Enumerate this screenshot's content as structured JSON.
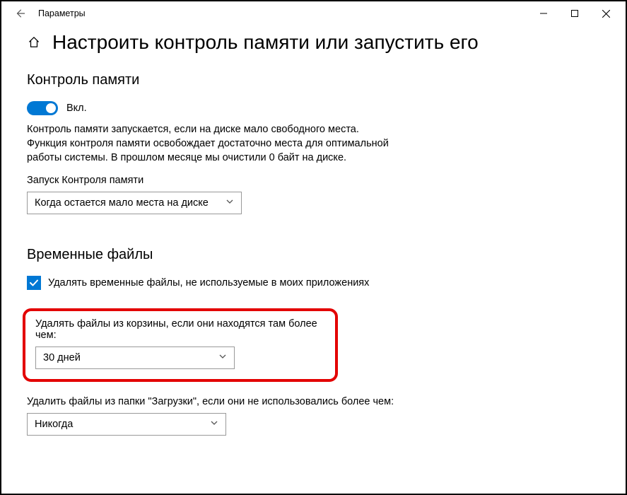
{
  "window": {
    "title": "Параметры"
  },
  "page": {
    "title": "Настроить контроль памяти или запустить его"
  },
  "section1": {
    "heading": "Контроль памяти",
    "toggle_label": "Вкл.",
    "description": "Контроль памяти запускается, если на диске мало свободного места. Функция контроля памяти освобождает достаточно места для оптимальной работы системы. В прошлом месяце мы очистили 0 байт на диске.",
    "run_label": "Запуск Контроля памяти",
    "run_value": "Когда остается мало места на диске"
  },
  "section2": {
    "heading": "Временные файлы",
    "checkbox_label": "Удалять временные файлы, не используемые в моих приложениях",
    "recycle_label": "Удалять файлы из корзины, если они находятся там более чем:",
    "recycle_value": "30 дней",
    "downloads_label": "Удалить файлы из папки \"Загрузки\", если они не использовались более чем:",
    "downloads_value": "Никогда"
  }
}
